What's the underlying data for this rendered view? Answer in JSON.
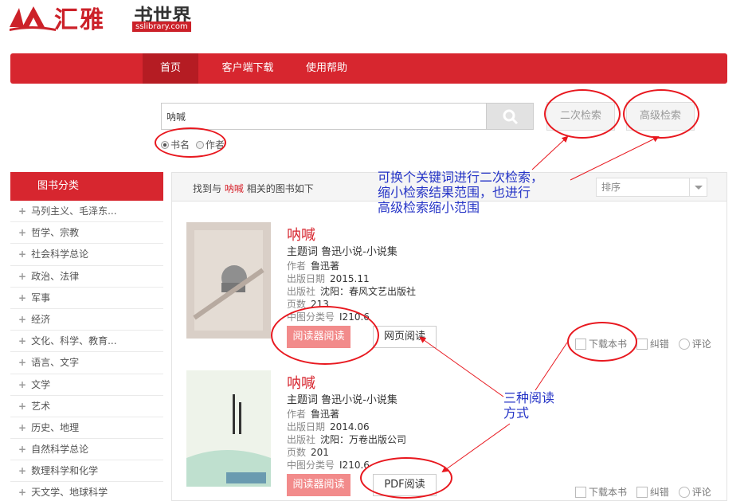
{
  "logo": {
    "brand": "汇雅",
    "suffix": "书世界",
    "url": "sslibrary.com"
  },
  "nav": {
    "items": [
      "首页",
      "客户端下载",
      "使用帮助"
    ]
  },
  "search": {
    "value": "呐喊",
    "second_search_label": "二次检索",
    "advanced_search_label": "高级检索",
    "options": [
      "书名",
      "作者"
    ]
  },
  "sidebar": {
    "title": "图书分类",
    "items": [
      "马列主义、毛泽东...",
      "哲学、宗教",
      "社会科学总论",
      "政治、法律",
      "军事",
      "经济",
      "文化、科学、教育...",
      "语言、文字",
      "文学",
      "艺术",
      "历史、地理",
      "自然科学总论",
      "数理科学和化学",
      "天文学、地球科学"
    ]
  },
  "results": {
    "prefix": "找到与",
    "keyword": "呐喊",
    "suffix": "相关的图书如下",
    "sort_label": "排序"
  },
  "labels": {
    "subject": "主题词",
    "author": "作者",
    "date": "出版日期",
    "publisher": "出版社",
    "pages": "页数",
    "clc": "中图分类号",
    "download": "下载本书",
    "error": "纠错",
    "comment": "评论",
    "reader": "阅读器阅读"
  },
  "books": [
    {
      "title": "呐喊",
      "subject": "鲁迅小说-小说集",
      "author": "鲁迅著",
      "date": "2015.11",
      "publisher": "沈阳：春风文艺出版社",
      "pages": "213",
      "clc": "I210.6",
      "alt_read": "网页阅读"
    },
    {
      "title": "呐喊",
      "subject": "鲁迅小说-小说集",
      "author": "鲁迅著",
      "date": "2014.06",
      "publisher": "沈阳：万卷出版公司",
      "pages": "201",
      "clc": "I210.6",
      "alt_read": "PDF阅读"
    }
  ],
  "annotations": {
    "note1": [
      "可换个关键词进行二次检索，",
      "缩小检索结果范围，也进行",
      "高级检索缩小范围"
    ],
    "note2": [
      "三种阅读",
      "方式"
    ]
  },
  "colors": {
    "brand_red": "#d7262f",
    "annotation_blue": "#2433c6"
  }
}
